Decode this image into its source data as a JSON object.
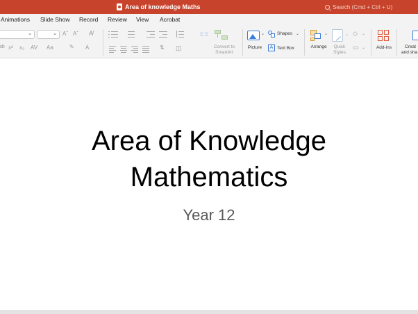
{
  "window": {
    "doc_title": "Area of knowledge Maths",
    "search_placeholder": "Search (Cmd + Ctrl + U)"
  },
  "menu": {
    "tabs": [
      "Animations",
      "Slide Show",
      "Record",
      "Review",
      "View",
      "Acrobat"
    ]
  },
  "ribbon": {
    "font_size_glyphs": [
      "Aˆ",
      "Aˇ"
    ],
    "subscript": "x₂",
    "superscript": "x²",
    "char_spacing": "AV",
    "change_case": "Aa",
    "font_color": "A",
    "convert_smartart": [
      "Convert to",
      "SmartArt"
    ],
    "picture": "Picture",
    "shapes": "Shapes",
    "text_box": "Text Box",
    "arrange": "Arrange",
    "quick_styles": [
      "Quick",
      "Styles"
    ],
    "add_ins": "Add-ins",
    "create_share": [
      "Creat",
      "and sha"
    ]
  },
  "slide": {
    "title_lines": [
      "Area of Knowledge",
      "Mathematics"
    ],
    "subtitle": "Year 12"
  },
  "colors": {
    "title_bar": "#c8432b",
    "ribbon_bg": "#f3f3f3",
    "add_ins_icon": "#e1573a",
    "picture_icon": "#3c7dd9"
  }
}
